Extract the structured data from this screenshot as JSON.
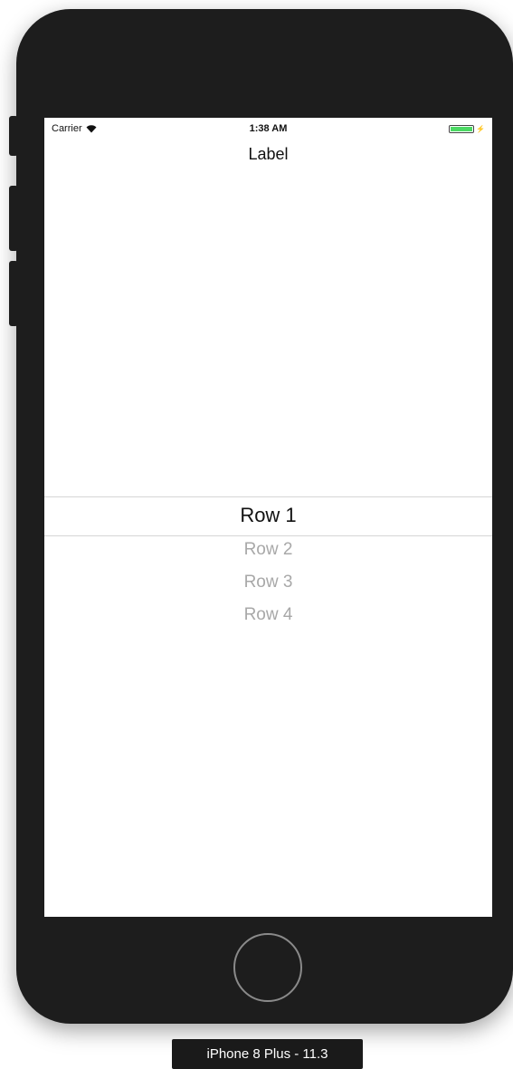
{
  "status_bar": {
    "carrier": "Carrier",
    "time": "1:38 AM",
    "battery_color": "#4cd964"
  },
  "content": {
    "label": "Label"
  },
  "picker": {
    "rows": [
      "Row 1",
      "Row 2",
      "Row 3",
      "Row 4"
    ],
    "selected_index": 0
  },
  "device": {
    "name": "iPhone 8 Plus - 11.3"
  },
  "colors": {
    "bezel": "#1d1d1d",
    "inactive_row": "#a8a8a8"
  }
}
